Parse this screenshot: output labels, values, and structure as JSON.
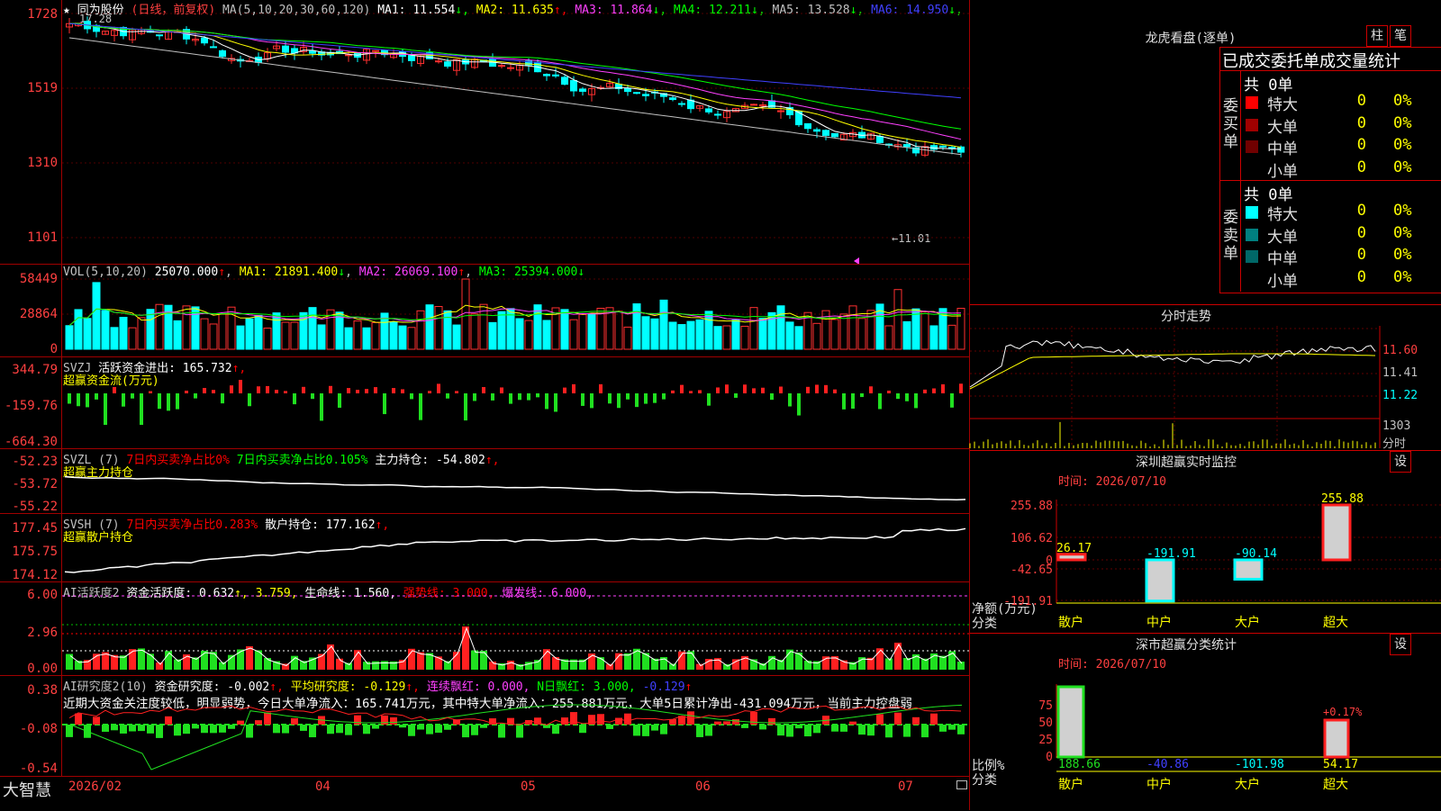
{
  "main_chart": {
    "stock_name": "同为股份",
    "period_label": "(日线，前复权)",
    "ma_config": "MA(5,10,20,30,60,120)",
    "ma_values": [
      {
        "label": "MA1:",
        "value": "11.554",
        "arrow": "↓",
        "color": "#ffffff"
      },
      {
        "label": "MA2:",
        "value": "11.635",
        "arrow": "↑",
        "color": "#ffff00"
      },
      {
        "label": "MA3:",
        "value": "11.864",
        "arrow": "↓",
        "color": "#ff40ff"
      },
      {
        "label": "MA4:",
        "value": "12.211",
        "arrow": "↓",
        "color": "#00ff00"
      },
      {
        "label": "MA5:",
        "value": "13.528",
        "arrow": "↓",
        "color": "#c0c0c0"
      },
      {
        "label": "MA6:",
        "value": "14.950",
        "arrow": "↓",
        "color": "#4040ff"
      }
    ],
    "y_labels": [
      "1728",
      "1519",
      "1310",
      "1101"
    ],
    "high_marker": "17.28",
    "low_marker": "←11.01"
  },
  "volume": {
    "header": "VOL(5,10,20)",
    "value": "25070.000",
    "value_arrow": "↑",
    "ma1": "MA1: 21891.400",
    "ma1_arrow": "↓",
    "ma2": "MA2: 26069.100",
    "ma2_arrow": "↑",
    "ma3": "MA3: 25394.000",
    "ma3_arrow": "↓",
    "y_labels": [
      "58449",
      "28864",
      "0"
    ]
  },
  "svzj": {
    "header": "SVZJ",
    "label": "活跃资金进出: 165.732",
    "arrow": "↑,",
    "sub": "超赢资金流(万元)",
    "y_labels": [
      "344.79",
      "-159.76",
      "-664.30"
    ]
  },
  "svzl": {
    "header": "SVZL (7)",
    "red_text": "7日内买卖净占比0%",
    "green_text": "7日内买卖净占比0.105%",
    "label": "主力持仓: -54.802",
    "arrow": "↑,",
    "sub": "超赢主力持仓",
    "y_labels": [
      "-52.23",
      "-53.72",
      "-55.22"
    ]
  },
  "svsh": {
    "header": "SVSH (7)",
    "red_text": "7日内买卖净占比0.283%",
    "label": "散户持仓: 177.162",
    "arrow": "↑,",
    "sub": "超赢散户持仓",
    "y_labels": [
      "177.45",
      "175.75",
      "174.12"
    ]
  },
  "ai_active": {
    "header": "AI活跃度2",
    "label": "资金活跃度: 0.632",
    "a1": "↑, 3.759,",
    "life": "生命线: 1.560,",
    "strong": "强势线: 3.000,",
    "burst": "爆发线: 6.000,",
    "y_labels": [
      "6.00",
      "2.96",
      "0.00"
    ]
  },
  "ai_research": {
    "header": "AI研究度2(10)",
    "label": "资金研究度: -0.002",
    "arrow": "↑,",
    "avg": "平均研究度: -0.129",
    "avg_arrow": "↑,",
    "streak": "连续飘红: 0.000,",
    "nday": "N日飘红: 3.000,",
    "extra": "-0.129",
    "extra_arrow": "↑",
    "comment": "近期大资金关注度较低，明显弱势，今日大单净流入：165.741万元，其中特大单净流入：255.881万元，大单5日累计净出-431.094万元，当前主力控盘弱",
    "y_labels": [
      "0.38",
      "-0.08",
      "-0.54"
    ]
  },
  "bottom": {
    "brand": "大智慧",
    "date_labels": [
      "2026/02",
      "04",
      "05",
      "06",
      "07"
    ]
  },
  "right_panel": {
    "dragon_title": "龙虎看盘(逐单)",
    "btn_pillar": "柱",
    "btn_pen": "笔",
    "section_title": "已成交委托单成交量统计",
    "buy_label": "委买单",
    "sell_label": "委卖单",
    "buy_total": "共 0单",
    "sell_total": "共 0单",
    "buy_rows": [
      {
        "label": "特大",
        "value": "0",
        "pct": "0%",
        "color": "#ff0000"
      },
      {
        "label": "大单",
        "value": "0",
        "pct": "0%",
        "color": "#a00000"
      },
      {
        "label": "中单",
        "value": "0",
        "pct": "0%",
        "color": "#700000"
      },
      {
        "label": "小单",
        "value": "0",
        "pct": "0%",
        "color": "#000000"
      }
    ],
    "sell_rows": [
      {
        "label": "特大",
        "value": "0",
        "pct": "0%",
        "color": "#00ffff"
      },
      {
        "label": "大单",
        "value": "0",
        "pct": "0%",
        "color": "#008080"
      },
      {
        "label": "中单",
        "value": "0",
        "pct": "0%",
        "color": "#006868"
      },
      {
        "label": "小单",
        "value": "0",
        "pct": "0%",
        "color": "#000000"
      }
    ],
    "intraday_title": "分时走势",
    "intraday_prices": [
      "11.60",
      "11.41",
      "11.22"
    ],
    "intraday_vol": "1303",
    "intraday_vol_label": "分时",
    "sz_title": "深圳超赢实时监控",
    "sz_btn": "设",
    "sz_time": "时间: 2026/07/10",
    "sz_y": [
      "255.88",
      "106.62",
      "0",
      "-42.65",
      "-191.91"
    ],
    "sz_axis_label": "净额(万元)",
    "sz_cat_label": "分类",
    "sz_bars": [
      {
        "cat": "散户",
        "value": 26.17,
        "label": "26.17"
      },
      {
        "cat": "中户",
        "value": -191.91,
        "label": "-191.91"
      },
      {
        "cat": "大户",
        "value": -90.14,
        "label": "-90.14"
      },
      {
        "cat": "超大",
        "value": 255.88,
        "label": "255.88"
      }
    ],
    "ss_title": "深市超赢分类统计",
    "ss_btn": "设",
    "ss_time": "时间: 2026/07/10",
    "ss_y": [
      "75",
      "50",
      "25",
      "0"
    ],
    "ss_axis_label": "比例%",
    "ss_cat_label": "分类",
    "ss_values": [
      "188.66",
      "-40.86",
      "-101.98",
      "54.17"
    ],
    "ss_cats": [
      "散户",
      "中户",
      "大户",
      "超大"
    ],
    "ss_annot": "+0.17%"
  }
}
